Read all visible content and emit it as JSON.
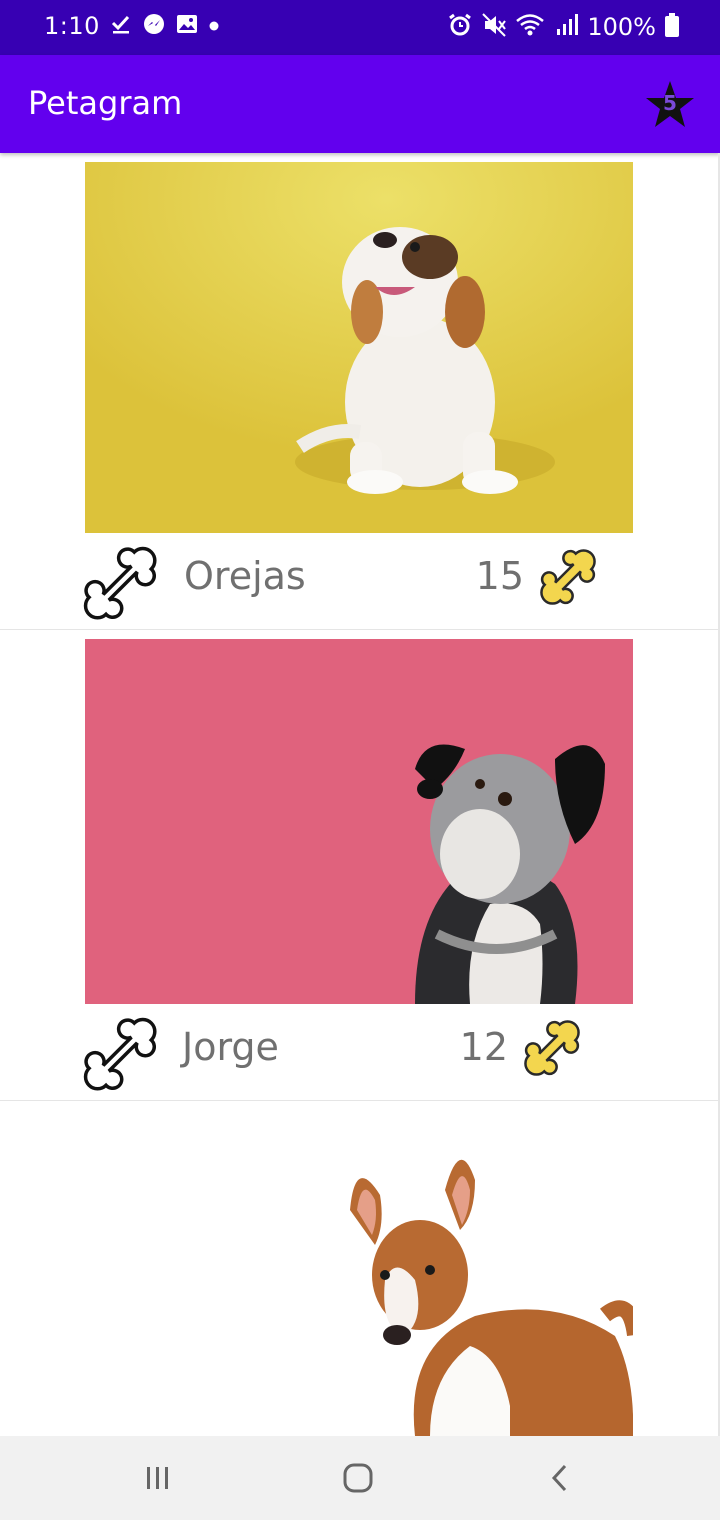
{
  "status_bar": {
    "time": "1:10",
    "battery": "100%",
    "left_icons": [
      "check-download-icon",
      "messenger-icon",
      "gallery-icon",
      "dot-icon"
    ],
    "right_icons": [
      "alarm-icon",
      "mute-icon",
      "wifi-icon",
      "signal-icon",
      "battery-icon"
    ]
  },
  "app_bar": {
    "title": "Petagram",
    "favorites_count": "5",
    "color": "#6200ee",
    "status_color": "#3700b3"
  },
  "pets": [
    {
      "name": "Orejas",
      "likes": "15",
      "photo_bg": "#e1c83f",
      "photo_desc": "beagle-puppy"
    },
    {
      "name": "Jorge",
      "likes": "12",
      "photo_bg": "#e0627d",
      "photo_desc": "schnauzer-mix"
    },
    {
      "name": "",
      "likes": "",
      "photo_bg": "#ffffff",
      "photo_desc": "basenji"
    }
  ],
  "nav": {
    "buttons": [
      "recents-button",
      "home-button",
      "back-button"
    ]
  }
}
